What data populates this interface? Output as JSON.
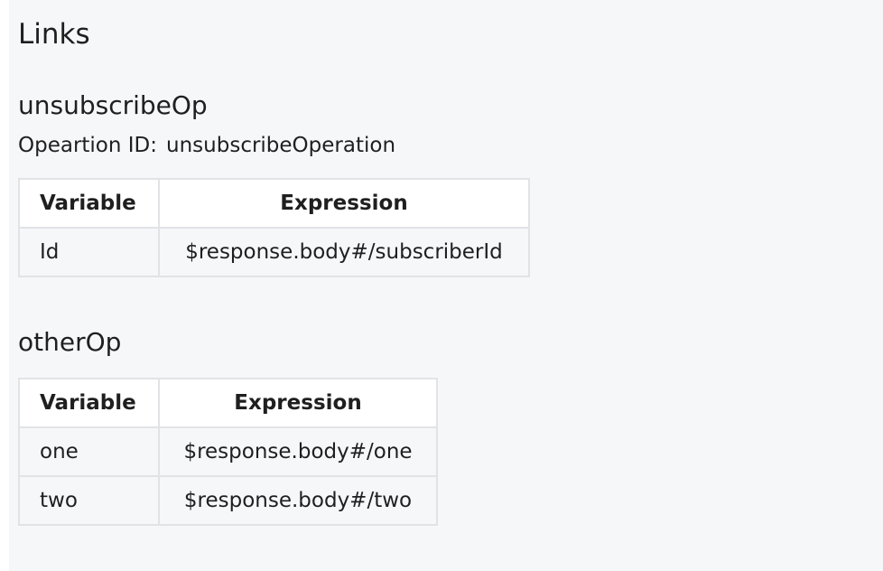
{
  "section": {
    "title": "Links"
  },
  "links": [
    {
      "name": "unsubscribeOp",
      "operation_label": "Opeartion ID:",
      "operation_id": "unsubscribeOperation",
      "headers": {
        "variable": "Variable",
        "expression": "Expression"
      },
      "rows": [
        {
          "variable": "Id",
          "expression": "$response.body#/subscriberId"
        }
      ]
    },
    {
      "name": "otherOp",
      "headers": {
        "variable": "Variable",
        "expression": "Expression"
      },
      "rows": [
        {
          "variable": "one",
          "expression": "$response.body#/one"
        },
        {
          "variable": "two",
          "expression": "$response.body#/two"
        }
      ]
    }
  ]
}
